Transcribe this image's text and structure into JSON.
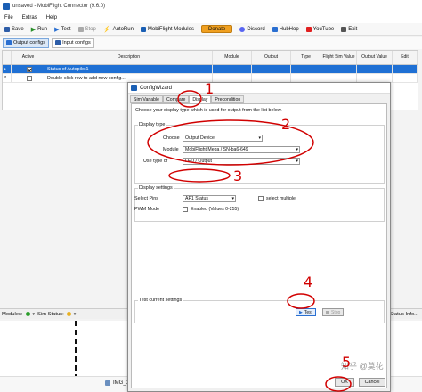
{
  "window": {
    "title": "unsaved - MobiFlight Connector (9.6.0)"
  },
  "menu": [
    "File",
    "Extras",
    "Help"
  ],
  "toolbar": {
    "save": "Save",
    "run": "Run",
    "test": "Test",
    "stop": "Stop",
    "autorun": "AutoRun",
    "modules": "MobiFlight Modules",
    "donate": "Donate",
    "discord": "Discord",
    "hubhop": "HubHop",
    "youtube": "YouTube",
    "exit": "Exit"
  },
  "view_tabs": {
    "output": "Output configs",
    "input": "Input configs"
  },
  "grid": {
    "headers": [
      "Active",
      "Description",
      "Module",
      "Output",
      "Type",
      "Flight Sim Value",
      "Output Value",
      "Edit"
    ],
    "rows": [
      {
        "active": true,
        "description": "Status of Autopilot1",
        "selected": true
      },
      {
        "active": false,
        "description": "Double-click row to add new config...",
        "selected": false
      }
    ]
  },
  "status": {
    "modules": "Modules:",
    "sim": "Sim Status:",
    "info": "Status Info..."
  },
  "dialog": {
    "title": "ConfigWizard",
    "tabs": [
      "Sim Variable",
      "Compare",
      "Display",
      "Precondition"
    ],
    "hint": "Choose your display type which is used for output from the list below.",
    "display_type": {
      "label": "Display type",
      "choose_label": "Choose",
      "choose_value": "Output Device",
      "module_label": "Module",
      "module_value": "MobiFlight Mega / SN-ba6-649",
      "use_type_label": "Use type of",
      "use_type_value": "LED / Output"
    },
    "display_settings": {
      "label": "Display settings",
      "select_pins_label": "Select Pins",
      "select_pins_value": "AP1 Status",
      "select_multiple": "select multiple",
      "pwm_label": "PWM Mode",
      "pwm_enabled": "Enabled (Values 0-255)"
    },
    "test_settings": {
      "label": "Test current settings",
      "test": "Test",
      "stop": "Stop"
    },
    "footer": {
      "ok": "OK",
      "cancel": "Cancel"
    }
  },
  "annotations": {
    "marks": [
      "1",
      "2",
      "3",
      "4",
      "5"
    ],
    "color": "#d10000"
  },
  "taskbar": {
    "file": "IMG_1919.jpeg"
  },
  "watermark": "知乎 @莫花"
}
